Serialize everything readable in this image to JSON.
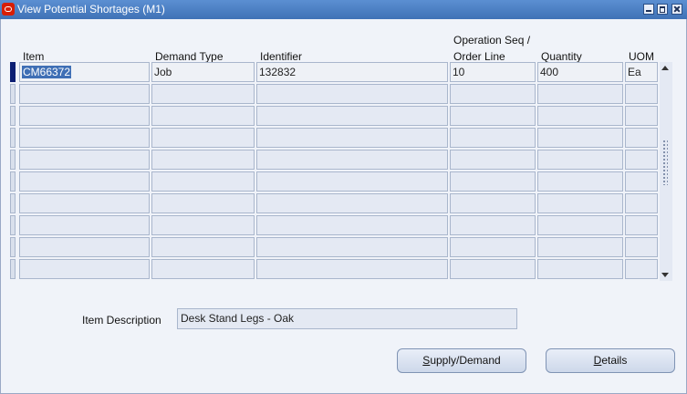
{
  "window": {
    "title": "View Potential Shortages (M1)",
    "icon": "oracle-logo-icon"
  },
  "table": {
    "headers": {
      "item": "Item",
      "demand_type": "Demand Type",
      "identifier": "Identifier",
      "operation_seq_line1": "Operation Seq /",
      "operation_seq_line2": "Order Line",
      "quantity": "Quantity",
      "uom": "UOM"
    },
    "rows": [
      {
        "item": "CM66372",
        "demand_type": "Job",
        "identifier": "132832",
        "operation_seq": "10",
        "quantity": "400",
        "uom": "Ea"
      },
      {
        "item": "",
        "demand_type": "",
        "identifier": "",
        "operation_seq": "",
        "quantity": "",
        "uom": ""
      },
      {
        "item": "",
        "demand_type": "",
        "identifier": "",
        "operation_seq": "",
        "quantity": "",
        "uom": ""
      },
      {
        "item": "",
        "demand_type": "",
        "identifier": "",
        "operation_seq": "",
        "quantity": "",
        "uom": ""
      },
      {
        "item": "",
        "demand_type": "",
        "identifier": "",
        "operation_seq": "",
        "quantity": "",
        "uom": ""
      },
      {
        "item": "",
        "demand_type": "",
        "identifier": "",
        "operation_seq": "",
        "quantity": "",
        "uom": ""
      },
      {
        "item": "",
        "demand_type": "",
        "identifier": "",
        "operation_seq": "",
        "quantity": "",
        "uom": ""
      },
      {
        "item": "",
        "demand_type": "",
        "identifier": "",
        "operation_seq": "",
        "quantity": "",
        "uom": ""
      },
      {
        "item": "",
        "demand_type": "",
        "identifier": "",
        "operation_seq": "",
        "quantity": "",
        "uom": ""
      },
      {
        "item": "",
        "demand_type": "",
        "identifier": "",
        "operation_seq": "",
        "quantity": "",
        "uom": ""
      }
    ]
  },
  "item_description": {
    "label": "Item Description",
    "value": "Desk Stand Legs - Oak"
  },
  "buttons": {
    "supply_demand_mnemonic": "S",
    "supply_demand_rest": "upply/Demand",
    "details_mnemonic": "D",
    "details_rest": "etails"
  },
  "colors": {
    "title_bar": "#4a7ec0",
    "current_row_indicator": "#0c1f73",
    "selection": "#3f6fb5"
  }
}
